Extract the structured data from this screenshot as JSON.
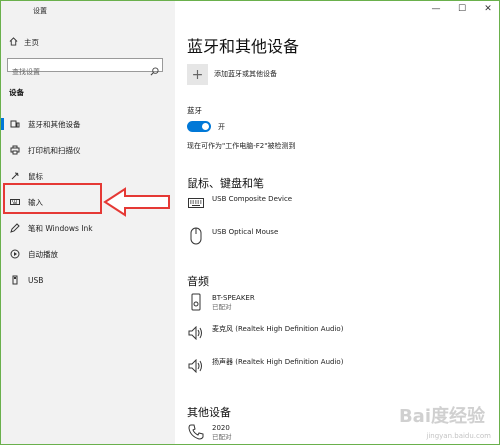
{
  "window": {
    "title": "设置",
    "controls": [
      "—",
      "☐",
      "✕"
    ]
  },
  "sidebar": {
    "home_label": "主页",
    "search_placeholder": "查找设置",
    "section_label": "设备",
    "items": [
      {
        "label": "蓝牙和其他设备",
        "icon": "bluetooth-devices-icon",
        "active": true
      },
      {
        "label": "打印机和扫描仪",
        "icon": "printer-icon"
      },
      {
        "label": "鼠标",
        "icon": "mouse-icon"
      },
      {
        "label": "输入",
        "icon": "keyboard-icon"
      },
      {
        "label": "笔和 Windows Ink",
        "icon": "pen-icon"
      },
      {
        "label": "自动播放",
        "icon": "autoplay-icon"
      },
      {
        "label": "USB",
        "icon": "usb-icon"
      }
    ]
  },
  "main": {
    "title": "蓝牙和其他设备",
    "add_device_label": "添加蓝牙或其他设备",
    "bluetooth": {
      "label": "蓝牙",
      "state_text": "开",
      "on": true
    },
    "discoverable_text": "现在可作为\"工作电脑-F2\"被检测到",
    "groups": [
      {
        "title": "鼠标、键盘和笔",
        "devices": [
          {
            "name": "USB Composite Device",
            "status": "",
            "icon": "keyboard-icon"
          },
          {
            "name": "USB Optical Mouse",
            "status": "",
            "icon": "mouse-icon"
          }
        ]
      },
      {
        "title": "音频",
        "devices": [
          {
            "name": "BT-SPEAKER",
            "status": "已配对",
            "icon": "speaker-device-icon"
          },
          {
            "name": "麦克风 (Realtek High Definition Audio)",
            "status": "",
            "icon": "audio-icon"
          },
          {
            "name": "扬声器 (Realtek High Definition Audio)",
            "status": "",
            "icon": "audio-icon"
          }
        ]
      },
      {
        "title": "其他设备",
        "devices": [
          {
            "name": "2020",
            "status": "已配对",
            "icon": "phone-icon"
          }
        ]
      }
    ]
  },
  "watermark": {
    "text": "Bai度经验",
    "sub": "jingyan.baidu.com"
  },
  "colors": {
    "accent": "#0078d7",
    "annotation": "#e53935",
    "sidebar_bg": "#f2f2f2"
  }
}
